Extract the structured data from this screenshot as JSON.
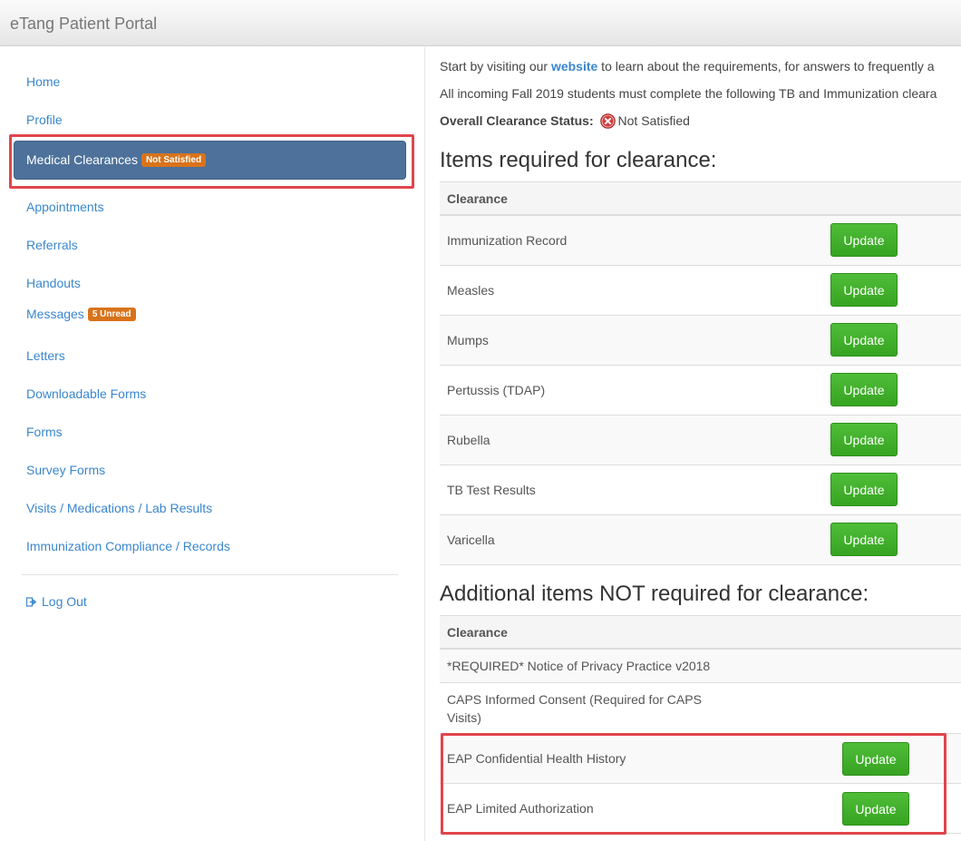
{
  "header": {
    "title": "eTang Patient Portal"
  },
  "sidebar": {
    "items": [
      {
        "label": "Home"
      },
      {
        "label": "Profile"
      },
      {
        "label": "Medical Clearances",
        "badge": "Not Satisfied",
        "active": true
      },
      {
        "label": "Appointments"
      },
      {
        "label": "Referrals"
      },
      {
        "label": "Handouts"
      },
      {
        "label": "Messages",
        "badge": "5 Unread"
      },
      {
        "label": "Letters"
      },
      {
        "label": "Downloadable Forms"
      },
      {
        "label": "Forms"
      },
      {
        "label": "Survey Forms"
      },
      {
        "label": "Visits / Medications / Lab Results"
      },
      {
        "label": "Immunization Compliance / Records"
      }
    ],
    "logout_label": "Log Out"
  },
  "main": {
    "intro_before": "Start by visiting our ",
    "intro_link": "website",
    "intro_after": " to learn about the requirements, for answers to frequently a",
    "intro2": "All incoming Fall 2019 students must complete the following TB and Immunization cleara",
    "status_label": "Overall Clearance Status:",
    "status_value": "Not Satisfied",
    "required": {
      "heading": "Items required for clearance:",
      "column": "Clearance",
      "rows": [
        {
          "name": "Immunization Record",
          "action": "Update"
        },
        {
          "name": "Measles",
          "action": "Update"
        },
        {
          "name": "Mumps",
          "action": "Update"
        },
        {
          "name": "Pertussis (TDAP)",
          "action": "Update"
        },
        {
          "name": "Rubella",
          "action": "Update"
        },
        {
          "name": "TB Test Results",
          "action": "Update"
        },
        {
          "name": "Varicella",
          "action": "Update"
        }
      ]
    },
    "additional": {
      "heading": "Additional items NOT required for clearance:",
      "column": "Clearance",
      "rows": [
        {
          "name": "*REQUIRED* Notice of Privacy Practice v2018"
        },
        {
          "name": "CAPS Informed Consent (Required for CAPS Visits)"
        },
        {
          "name": "EAP Confidential Health History",
          "action": "Update"
        },
        {
          "name": "EAP Limited Authorization",
          "action": "Update"
        }
      ]
    }
  },
  "colors": {
    "link": "#3a87ce",
    "active_nav": "#4d719a",
    "badge": "#d8731b",
    "update_button": "#3fae2a",
    "highlight": "#e0454c"
  }
}
